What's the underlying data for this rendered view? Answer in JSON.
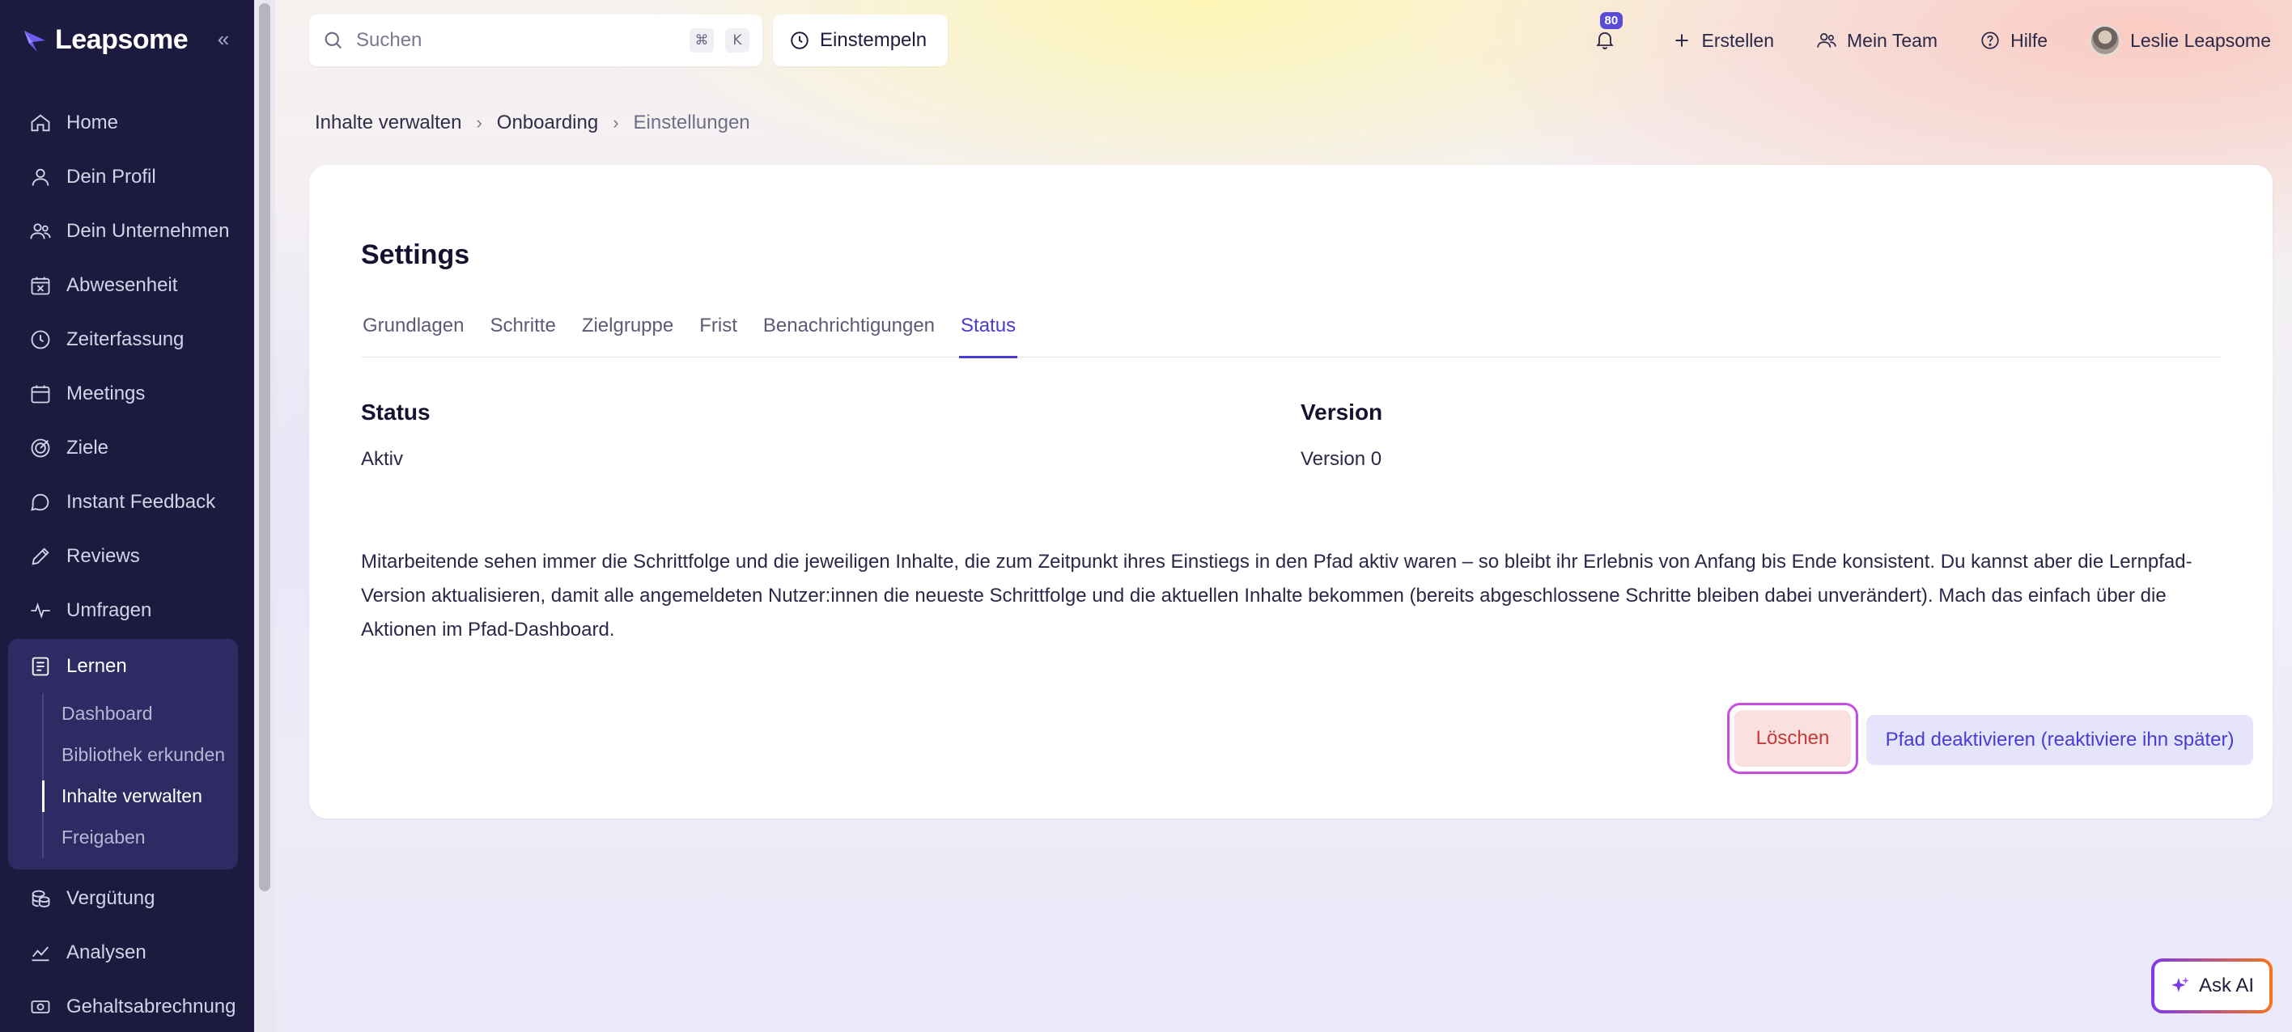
{
  "app": {
    "logo": "Leapsome"
  },
  "sidebar": {
    "items": [
      {
        "label": "Home",
        "icon": "home-icon"
      },
      {
        "label": "Dein Profil",
        "icon": "user-icon"
      },
      {
        "label": "Dein Unternehmen",
        "icon": "users-icon"
      },
      {
        "label": "Abwesenheit",
        "icon": "calendar-x-icon"
      },
      {
        "label": "Zeiterfassung",
        "icon": "clock-icon"
      },
      {
        "label": "Meetings",
        "icon": "calendar-icon"
      },
      {
        "label": "Ziele",
        "icon": "target-icon"
      },
      {
        "label": "Instant Feedback",
        "icon": "chat-icon"
      },
      {
        "label": "Reviews",
        "icon": "pen-icon"
      },
      {
        "label": "Umfragen",
        "icon": "pulse-icon"
      }
    ],
    "learn": {
      "label": "Lernen",
      "icon": "book-icon",
      "subitems": [
        {
          "label": "Dashboard",
          "active": false
        },
        {
          "label": "Bibliothek erkunden",
          "active": false
        },
        {
          "label": "Inhalte verwalten",
          "active": true
        },
        {
          "label": "Freigaben",
          "active": false
        }
      ]
    },
    "bottom_items": [
      {
        "label": "Vergütung",
        "icon": "coins-icon"
      },
      {
        "label": "Analysen",
        "icon": "chart-icon"
      },
      {
        "label": "Gehaltsabrechnung",
        "icon": "money-icon"
      }
    ]
  },
  "topbar": {
    "search_placeholder": "Suchen",
    "shortcut_mod": "⌘",
    "shortcut_key": "K",
    "clockin_label": "Einstempeln",
    "notification_count": "80",
    "create_label": "Erstellen",
    "team_label": "Mein Team",
    "help_label": "Hilfe",
    "user_name": "Leslie Leapsome"
  },
  "breadcrumb": [
    "Inhalte verwalten",
    "Onboarding",
    "Einstellungen"
  ],
  "page": {
    "title": "Settings",
    "tabs": [
      "Grundlagen",
      "Schritte",
      "Zielgruppe",
      "Frist",
      "Benachrichtigungen",
      "Status"
    ],
    "active_tab": "Status",
    "status_label": "Status",
    "status_value": "Aktiv",
    "version_label": "Version",
    "version_value": "Version 0",
    "description": "Mitarbeitende sehen immer die Schrittfolge und die jeweiligen Inhalte, die zum Zeitpunkt ihres Einstiegs in den Pfad aktiv waren – so bleibt ihr Erlebnis von Anfang bis Ende konsistent. Du kannst aber die Lernpfad-Version aktualisieren, damit alle angemeldeten Nutzer:innen die neueste Schrittfolge und die aktuellen Inhalte bekommen (bereits abgeschlossene Schritte bleiben dabei unverändert). Mach das einfach über die Aktionen im Pfad-Dashboard.",
    "delete_label": "Löschen",
    "deactivate_label": "Pfad deaktivieren (reaktiviere ihn später)"
  },
  "assistant": {
    "label": "Ask AI"
  },
  "colors": {
    "sidebar_bg": "#1d1a40",
    "accent": "#4a3bd1",
    "delete_bg": "#fbe0e0",
    "delete_text": "#c43a3a",
    "badge": "#5b4bd6"
  }
}
